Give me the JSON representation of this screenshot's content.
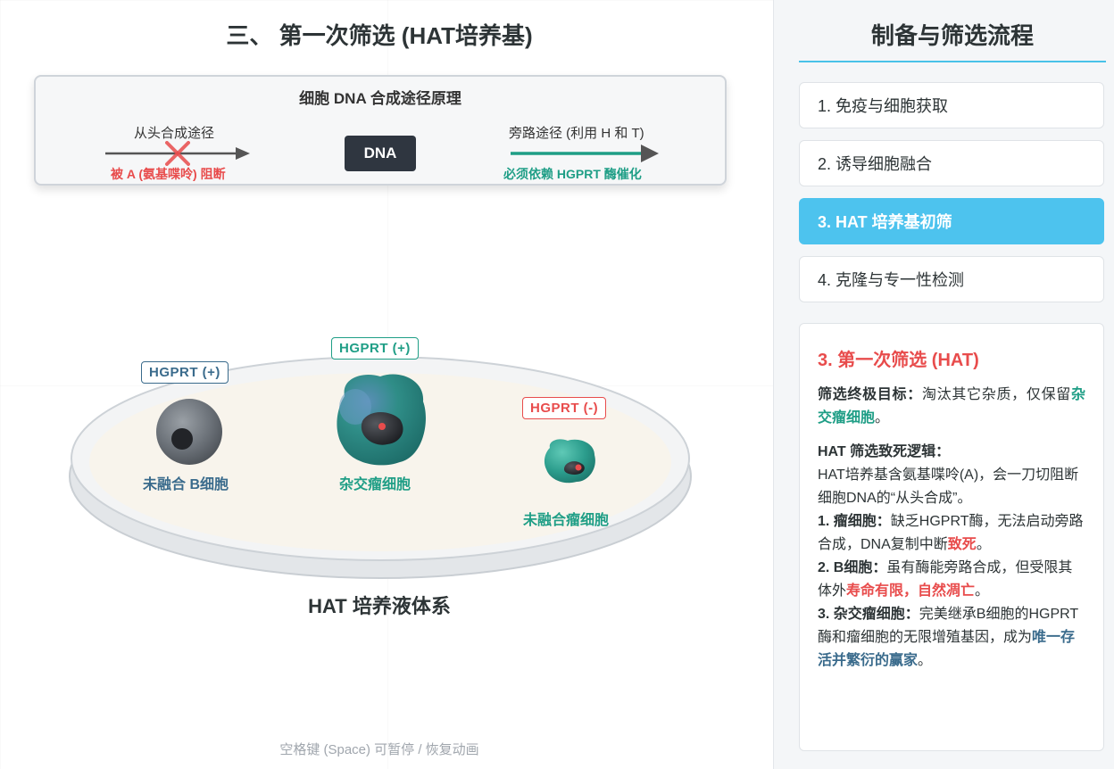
{
  "stage": {
    "title": "三、 第一次筛选 (HAT培养基)",
    "principle": {
      "title": "细胞 DNA 合成途径原理",
      "de_novo_label": "从头合成途径",
      "de_novo_note": "被 A (氨基喋呤) 阻断",
      "dna_label": "DNA",
      "salvage_label": "旁路途径 (利用 H 和 T)",
      "salvage_note": "必须依赖 HGPRT 酶催化"
    },
    "cells": [
      {
        "tag": "HGPRT (+)",
        "label": "未融合 B细胞",
        "tag_color": "#3a6b8c"
      },
      {
        "tag": "HGPRT (+)",
        "label": "杂交瘤细胞",
        "tag_color": "#1f9e86"
      },
      {
        "tag": "HGPRT (-)",
        "label": "未融合瘤细胞",
        "tag_color": "#e84c4c"
      }
    ],
    "system_label": "HAT 培养液体系",
    "hint": "空格键 (Space) 可暂停 / 恢复动画"
  },
  "sidebar": {
    "title": "制备与筛选流程",
    "steps": [
      {
        "label": "1. 免疫与细胞获取",
        "active": false
      },
      {
        "label": "2. 诱导细胞融合",
        "active": false
      },
      {
        "label": "3. HAT 培养基初筛",
        "active": true
      },
      {
        "label": "4. 克隆与专一性检测",
        "active": false
      }
    ],
    "detail": {
      "title": "3. 第一次筛选 (HAT)",
      "goal_label": "筛选终极目标：",
      "goal_text": "淘汰其它杂质，仅保留",
      "goal_highlight": "杂交瘤细胞",
      "goal_end": "。",
      "logic_title": "HAT 筛选致死逻辑：",
      "logic_intro": "HAT培养基含氨基喋呤(A)，会一刀切阻断细胞DNA的“从头合成”。",
      "item1_label": "1. 瘤细胞：",
      "item1_text": "缺乏HGPRT酶，无法启动旁路合成，DNA复制中断",
      "item1_highlight": "致死",
      "item1_end": "。",
      "item2_label": "2. B细胞：",
      "item2_text": "虽有酶能旁路合成，但受限其体外",
      "item2_highlight": "寿命有限，自然凋亡",
      "item2_end": "。",
      "item3_label": "3. 杂交瘤细胞：",
      "item3_text": "完美继承B细胞的HGPRT酶和瘤细胞的无限增殖基因，成为",
      "item3_highlight": "唯一存活并繁衍的赢家",
      "item3_end": "。"
    }
  },
  "colors": {
    "accent": "#4dc3ee",
    "red": "#e84c4c",
    "teal": "#1f9e86",
    "blue": "#3a6b8c",
    "dark": "#2f3640"
  }
}
